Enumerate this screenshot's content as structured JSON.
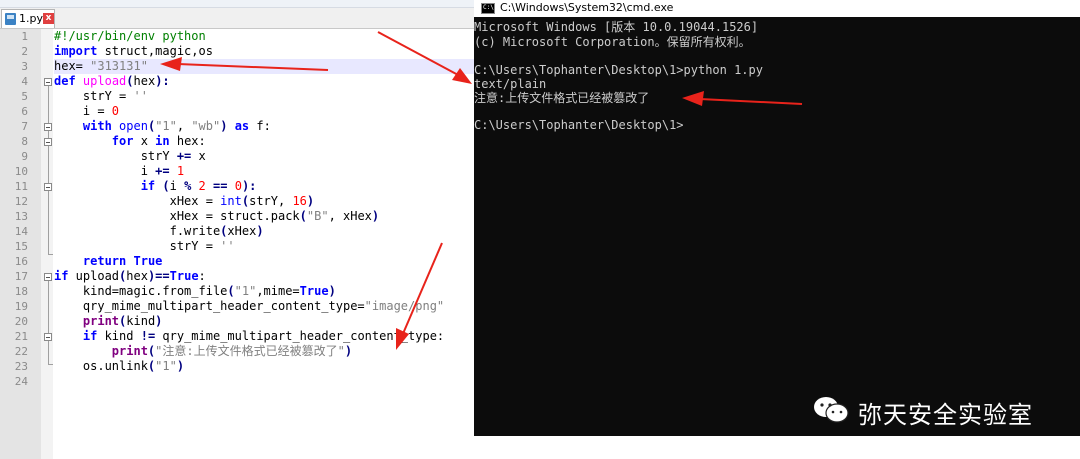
{
  "editor": {
    "tab_label": "1.py",
    "tab_close": "x",
    "line_numbers": [
      "1",
      "2",
      "3",
      "4",
      "5",
      "6",
      "7",
      "8",
      "9",
      "10",
      "11",
      "12",
      "13",
      "14",
      "15",
      "16",
      "17",
      "18",
      "19",
      "20",
      "21",
      "22",
      "23",
      "24"
    ]
  },
  "console": {
    "title": "C:\\Windows\\System32\\cmd.exe",
    "lines": [
      "Microsoft Windows [版本 10.0.19044.1526]",
      "(c) Microsoft Corporation。保留所有权利。",
      "",
      "C:\\Users\\Tophanter\\Desktop\\1>python 1.py",
      "text/plain",
      "注意:上传文件格式已经被篡改了",
      "",
      "C:\\Users\\Tophanter\\Desktop\\1>"
    ]
  },
  "watermark": {
    "text": "弥天安全实验室"
  },
  "colors": {
    "arrow": "#e8231b",
    "console_bg": "#0c0c0c",
    "keyword": "#0000ff",
    "string": "#808080",
    "number": "#ff0000"
  }
}
